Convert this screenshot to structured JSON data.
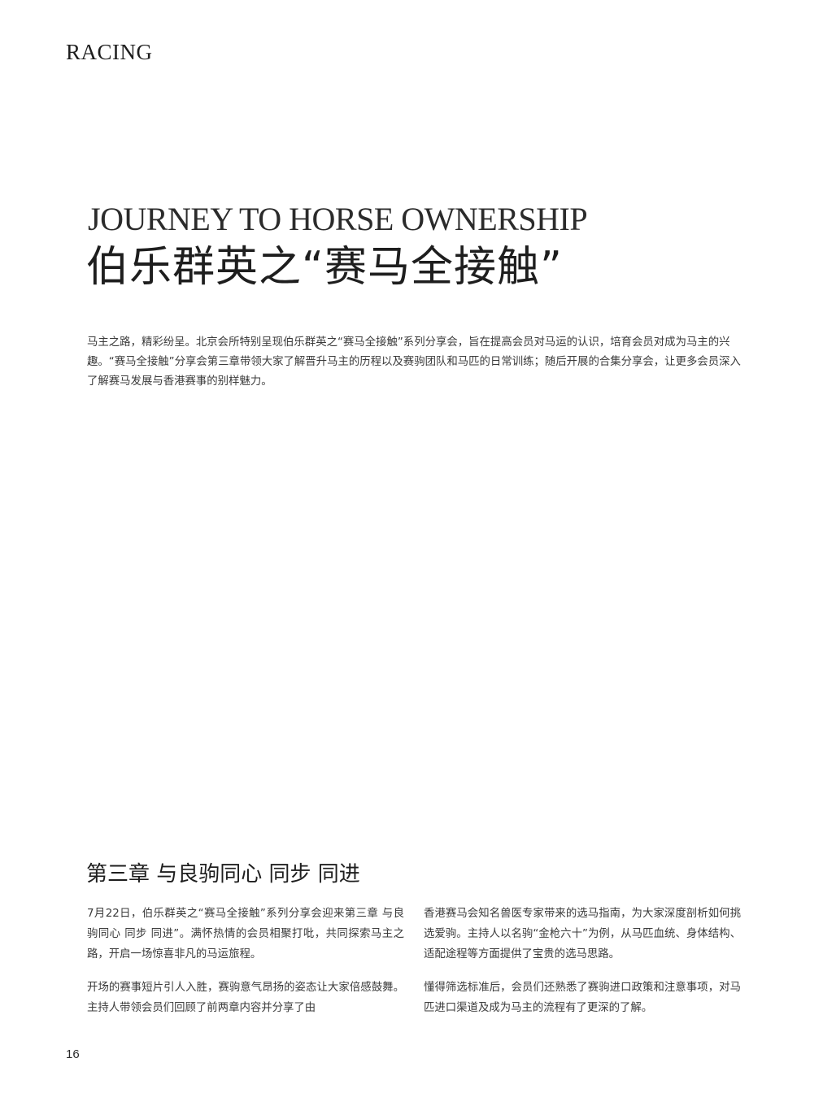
{
  "section": "RACING",
  "title": {
    "en": "JOURNEY TO HORSE OWNERSHIP",
    "zh": "伯乐群英之“赛马全接触”"
  },
  "intro": "马主之路，精彩纷呈。北京会所特别呈现伯乐群英之“赛马全接触”系列分享会，旨在提高会员对马运的认识，培育会员对成为马主的兴趣。“赛马全接触”分享会第三章带领大家了解晋升马主的历程以及赛驹团队和马匹的日常训练；随后开展的合集分享会，让更多会员深入了解赛马发展与香港赛事的别样魅力。",
  "chapter": {
    "heading": "第三章 与良驹同心 同步 同进",
    "left_column": [
      "7月22日，伯乐群英之“赛马全接触”系列分享会迎来第三章 与良驹同心 同步 同进”。满怀热情的会员相聚打吡，共同探索马主之路，开启一场惊喜非凡的马运旅程。",
      "开场的赛事短片引人入胜，赛驹意气昂扬的姿态让大家倍感鼓舞。主持人带领会员们回顾了前两章内容并分享了由"
    ],
    "right_column": [
      "香港赛马会知名兽医专家带来的选马指南，为大家深度剖析如何挑选爱驹。主持人以名驹“金枪六十”为例，从马匹血统、身体结构、适配途程等方面提供了宝贵的选马思路。",
      "懂得筛选标准后，会员们还熟悉了赛驹进口政策和注意事项，对马匹进口渠道及成为马主的流程有了更深的了解。"
    ]
  },
  "page_number": "16"
}
